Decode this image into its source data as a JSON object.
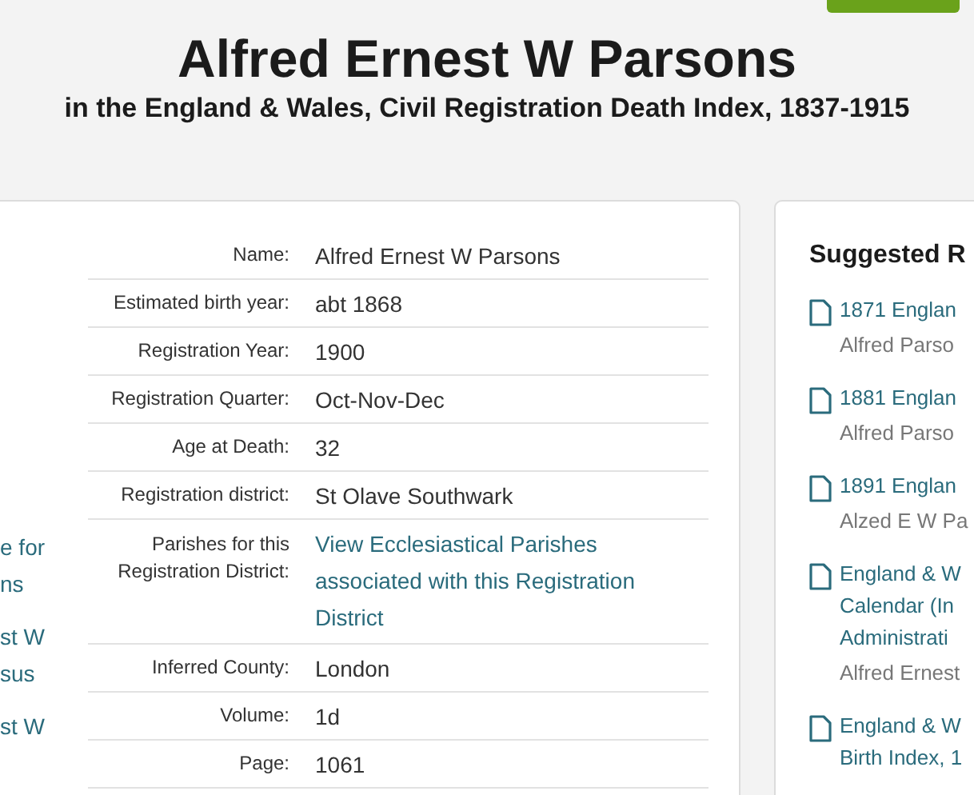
{
  "header": {
    "title": "Alfred Ernest W Parsons",
    "subtitle": "in the England & Wales, Civil Registration Death Index, 1837-1915"
  },
  "left_column": {
    "links": [
      {
        "lines": [
          "e for",
          "ns"
        ]
      },
      {
        "lines": [
          "st W",
          "sus"
        ]
      },
      {
        "lines": [
          "st W"
        ]
      }
    ]
  },
  "record": {
    "rows": [
      {
        "label": "Name:",
        "value": "Alfred Ernest W Parsons",
        "kind": "text"
      },
      {
        "label": "Estimated birth year:",
        "value": "abt 1868",
        "kind": "text"
      },
      {
        "label": "Registration Year:",
        "value": "1900",
        "kind": "text"
      },
      {
        "label": "Registration Quarter:",
        "value": "Oct-Nov-Dec",
        "kind": "text"
      },
      {
        "label": "Age at Death:",
        "value": "32",
        "kind": "text"
      },
      {
        "label": "Registration district:",
        "value": "St Olave Southwark",
        "kind": "text"
      },
      {
        "label": "Parishes for this Registration District:",
        "value": "View Ecclesiastical Parishes associated with this Registration District",
        "kind": "link"
      },
      {
        "label": "Inferred County:",
        "value": "London",
        "kind": "text"
      },
      {
        "label": "Volume:",
        "value": "1d",
        "kind": "text"
      },
      {
        "label": "Page:",
        "value": "1061",
        "kind": "text"
      }
    ]
  },
  "suggested": {
    "title": "Suggested R",
    "items": [
      {
        "link_lines": [
          "1871 Englan"
        ],
        "detail": "Alfred Parso"
      },
      {
        "link_lines": [
          "1881 Englan"
        ],
        "detail": "Alfred Parso"
      },
      {
        "link_lines": [
          "1891 Englan"
        ],
        "detail": "Alzed E W Pa"
      },
      {
        "link_lines": [
          "England & W",
          "Calendar (In",
          "Administrati"
        ],
        "detail": "Alfred Ernest"
      },
      {
        "link_lines": [
          "England & W",
          "Birth Index, 1"
        ]
      }
    ]
  }
}
